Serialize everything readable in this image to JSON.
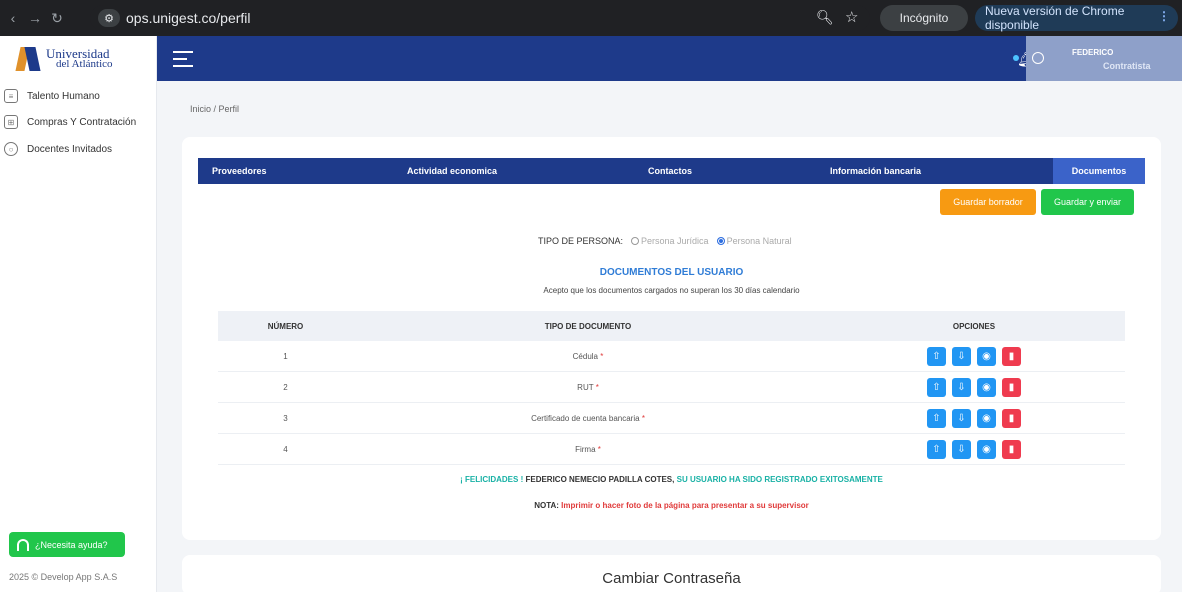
{
  "browser": {
    "url": "ops.unigest.co/perfil",
    "incognito_label": "Incógnito",
    "update_label": "Nueva versión de Chrome disponible"
  },
  "sidebar": {
    "logo_line1": "Universidad",
    "logo_line2": "del Atlántico",
    "items": [
      {
        "label": "Talento Humano"
      },
      {
        "label": "Compras Y Contratación"
      },
      {
        "label": "Docentes Invitados"
      }
    ],
    "help_label": "¿Necesita ayuda?",
    "copyright": "2025 © Develop App S.A.S"
  },
  "topbar": {
    "user_name": "FEDERICO",
    "user_role": "Contratista"
  },
  "breadcrumb": "Inicio / Perfil",
  "tabs": [
    {
      "label": "Proveedores",
      "active": false
    },
    {
      "label": "Actividad economica",
      "active": false
    },
    {
      "label": "Contactos",
      "active": false
    },
    {
      "label": "Información bancaria",
      "active": false
    },
    {
      "label": "Documentos",
      "active": true
    }
  ],
  "actions": {
    "draft_label": "Guardar borrador",
    "send_label": "Guardar y enviar"
  },
  "persona": {
    "label": "TIPO DE PERSONA:",
    "options": [
      "Persona Jurídica",
      "Persona Natural"
    ],
    "selected": "Persona Natural"
  },
  "documents": {
    "title": "DOCUMENTOS DEL USUARIO",
    "subtitle": "Acepto que los documentos cargados no superan los 30 días calendario",
    "headers": {
      "number": "NÚMERO",
      "type": "TIPO DE DOCUMENTO",
      "options": "OPCIONES"
    },
    "rows": [
      {
        "number": "1",
        "type": "Cédula",
        "required": "*"
      },
      {
        "number": "2",
        "type": "RUT",
        "required": "*"
      },
      {
        "number": "3",
        "type": "Certificado de cuenta bancaria",
        "required": "*"
      },
      {
        "number": "4",
        "type": "Firma",
        "required": "*"
      }
    ]
  },
  "messages": {
    "congrats_prefix": "¡ FELICIDADES !",
    "congrats_name": "FEDERICO NEMECIO PADILLA COTES,",
    "congrats_suffix": "SU USUARIO HA SIDO REGISTRADO EXITOSAMENTE",
    "nota_label": "NOTA:",
    "nota_text": "Imprimir o hacer foto de la página para presentar a su supervisor"
  },
  "password_section": {
    "title": "Cambiar Contraseña"
  },
  "colors": {
    "primary": "#1e3a8a",
    "active_tab": "#3b63c9",
    "draft": "#f79a12",
    "send": "#21c64b",
    "action_blue": "#2196f3",
    "action_red": "#ef3b4f"
  }
}
